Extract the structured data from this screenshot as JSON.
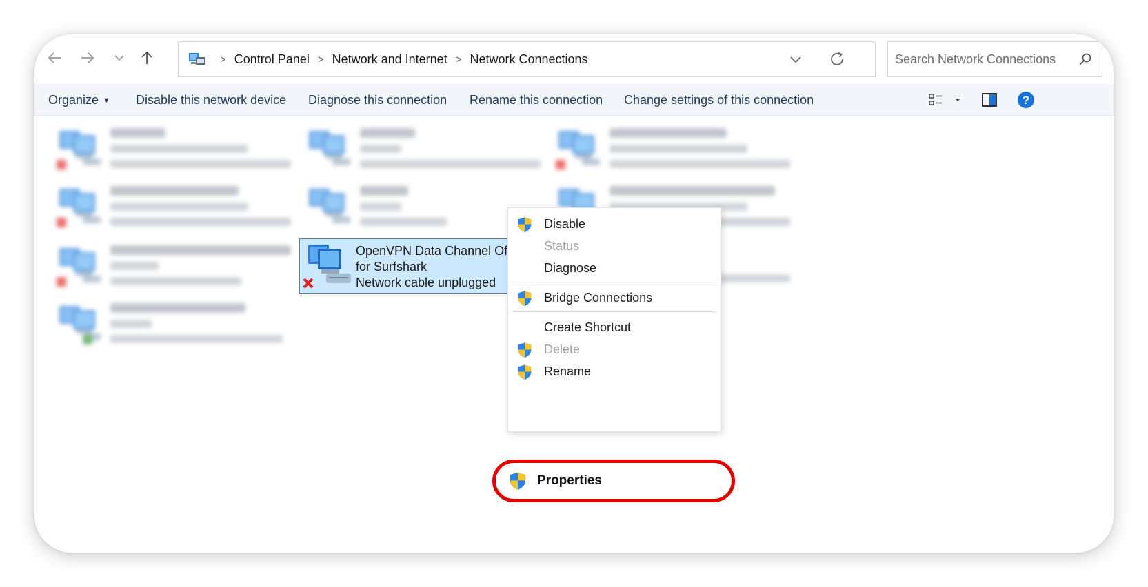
{
  "address": {
    "crumbs": [
      "Control Panel",
      "Network and Internet",
      "Network Connections"
    ],
    "search_placeholder": "Search Network Connections"
  },
  "toolbar": {
    "organize": "Organize",
    "disable": "Disable this network device",
    "diagnose": "Diagnose this connection",
    "rename": "Rename this connection",
    "change_settings": "Change settings of this connection"
  },
  "selected_connection": {
    "name": "OpenVPN Data Channel Offload for Surfshark",
    "status": "Network cable unplugged"
  },
  "context_menu": {
    "disable": "Disable",
    "status": "Status",
    "diagnose": "Diagnose",
    "bridge": "Bridge Connections",
    "create_shortcut": "Create Shortcut",
    "delete": "Delete",
    "rename": "Rename",
    "properties": "Properties"
  },
  "colors": {
    "highlight_ring": "#e60000",
    "selection_fill": "#cce8ff",
    "command_text": "#1e395b",
    "help_blue": "#1a73d9"
  }
}
